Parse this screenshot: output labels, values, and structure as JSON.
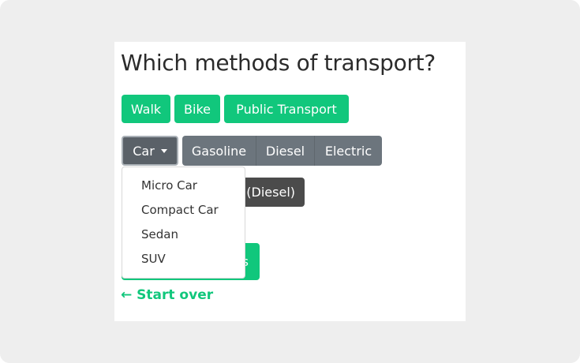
{
  "heading": "Which methods of transport?",
  "modes": [
    "Walk",
    "Bike",
    "Public Transport"
  ],
  "car_group": {
    "dropdown_label": "Car",
    "fuels": [
      "Gasoline",
      "Diesel",
      "Electric"
    ]
  },
  "dropdown_menu": {
    "items": [
      "Micro Car",
      "Compact Car",
      "Sedan",
      "SUV"
    ]
  },
  "selected_chip": {
    "visible_text": "(Diesel)"
  },
  "next_button": {
    "visible_text": "s"
  },
  "start_over": "← Start over",
  "colors": {
    "accent_green": "#11c77c",
    "button_grey": "#6c757d",
    "chip_dark": "#4b4b4b"
  }
}
